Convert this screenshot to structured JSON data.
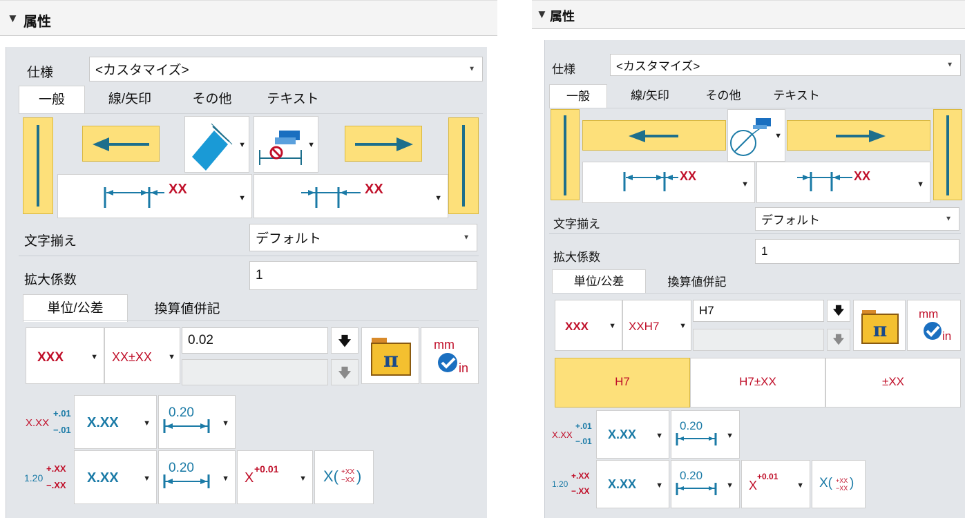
{
  "colors": {
    "accent_yellow": "#fde07a",
    "dim_blue": "#1a7aa6",
    "dim_red": "#c0102a",
    "panel_bg": "#e3e6ea"
  },
  "panels": [
    {
      "header": {
        "toggle_icon": "▼",
        "title": "属性"
      },
      "spec": {
        "label": "仕様",
        "value": "<カスタマイズ>"
      },
      "main_tabs": [
        "一般",
        "線/矢印",
        "その他",
        "テキスト"
      ],
      "arrow_icons": {
        "dim_text_1": "XX",
        "dim_text_2": "XX"
      },
      "text_align": {
        "label": "文字揃え",
        "value": "デフォルト"
      },
      "scale": {
        "label": "拡大係数",
        "value": "1"
      },
      "unit_tabs": [
        "単位/公差",
        "換算値併記"
      ],
      "precision": {
        "value": "XXX",
        "tol_format": "XX±XX"
      },
      "tolerance": {
        "value": "0.02",
        "secondary": ""
      },
      "tol_rows": {
        "row1_icon": "X.XX+.01−.01",
        "row1_value": "X.XX",
        "row1_dim": "0.20",
        "row2_icon": "1.20+.XX−.XX",
        "row2_value": "X.XX",
        "row2_dim": "0.20",
        "row2_super": "X+0.01",
        "row2_paren": "X(+XX−XX)"
      },
      "unit_icon": {
        "top": "mm",
        "bottom": "in"
      }
    },
    {
      "header": {
        "toggle_icon": "▼",
        "title": "属性"
      },
      "spec": {
        "label": "仕様",
        "value": "<カスタマイズ>"
      },
      "main_tabs": [
        "一般",
        "線/矢印",
        "その他",
        "テキスト"
      ],
      "arrow_icons": {
        "dim_text_1": "XX",
        "dim_text_2": "XX"
      },
      "text_align": {
        "label": "文字揃え",
        "value": "デフォルト"
      },
      "scale": {
        "label": "拡大係数",
        "value": "1"
      },
      "unit_tabs": [
        "単位/公差",
        "換算値併記"
      ],
      "precision": {
        "value": "XXX",
        "tol_format": "XXH7"
      },
      "tolerance": {
        "value": "H7",
        "secondary": ""
      },
      "fit_options": [
        "H7",
        "H7±XX",
        "±XX"
      ],
      "tol_rows": {
        "row1_icon": "X.XX+.01−.01",
        "row1_value": "X.XX",
        "row1_dim": "0.20",
        "row2_icon": "1.20+.XX−.XX",
        "row2_value": "X.XX",
        "row2_dim": "0.20",
        "row2_super": "X+0.01",
        "row2_paren": "X(+XX−XX)"
      },
      "unit_icon": {
        "top": "mm",
        "bottom": "in"
      }
    }
  ]
}
